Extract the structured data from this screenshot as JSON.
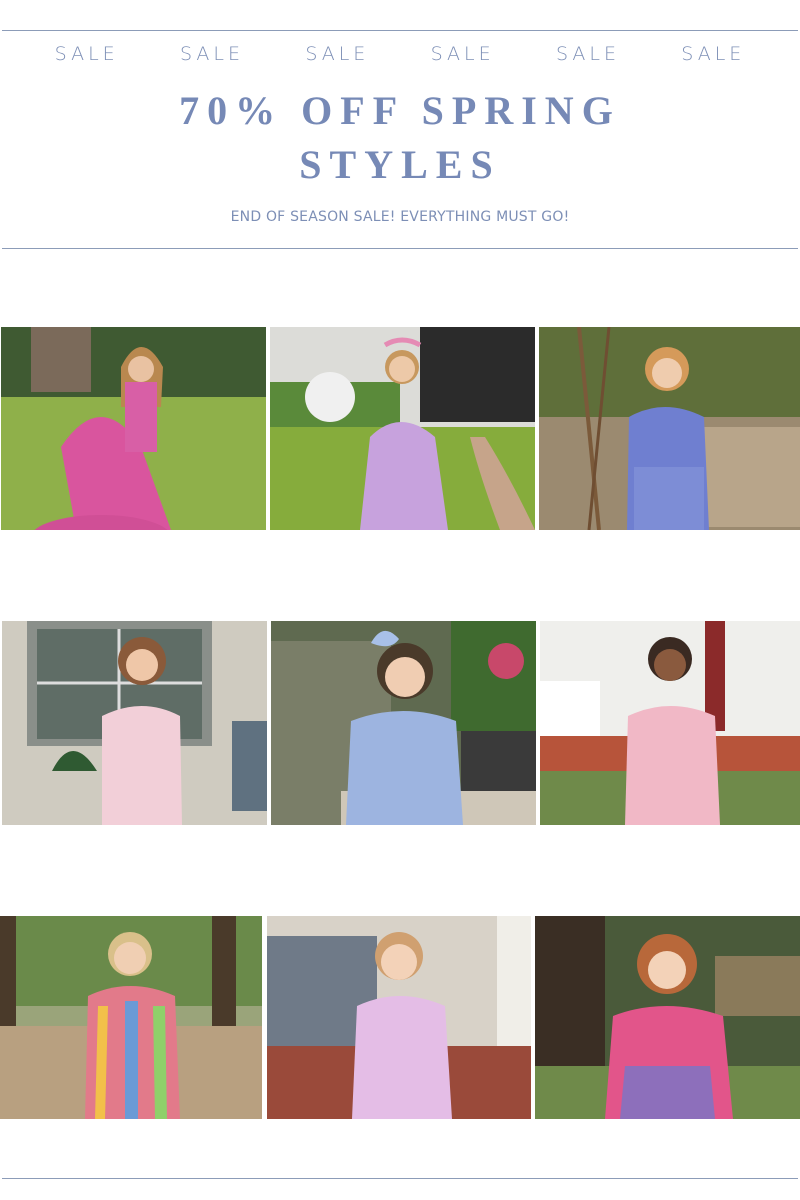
{
  "banner": {
    "sale_words": [
      "SALE",
      "SALE",
      "SALE",
      "SALE",
      "SALE",
      "SALE"
    ],
    "headline_line1": "70% OFF SPRING",
    "headline_line2": "STYLES",
    "subheadline": "END OF SEASON SALE! EVERYTHING MUST GO!"
  },
  "colors": {
    "accent": "#7689b6",
    "rule": "#8c9cb8"
  },
  "photos": [
    {
      "subject": "girl-pink-floral-tiered-dress"
    },
    {
      "subject": "girl-lilac-floral-flutter-dress"
    },
    {
      "subject": "girl-blue-smocked-top-skirt"
    },
    {
      "subject": "girl-pink-floral-romper"
    },
    {
      "subject": "girl-blue-plaid-dress"
    },
    {
      "subject": "girl-pink-floral-flutter-dress"
    },
    {
      "subject": "girl-rainbow-stripe-dress"
    },
    {
      "subject": "toddler-pink-floral-halter-dress"
    },
    {
      "subject": "girl-pink-smocked-floral-top"
    }
  ]
}
